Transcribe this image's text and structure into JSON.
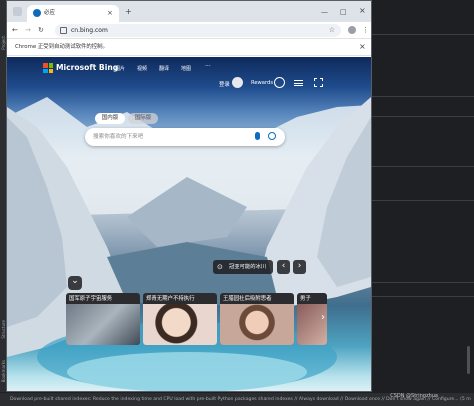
{
  "ide": {
    "left_labels": [
      "Project",
      "Structure",
      "Bookmarks"
    ],
    "status_text": "Download pre-built shared indexes: Reduce the indexing time and CPU load with pre-built Python packages shared indexes // Always download // Download once // Don't show again // Configure... (5 m",
    "watermark": "CSDN @Stringzhua"
  },
  "browser": {
    "tab_title": "必应",
    "tab_close": "×",
    "new_tab": "+",
    "window_controls": {
      "minimize": "—",
      "maximize": "□",
      "close": "×"
    },
    "url": "cn.bing.com",
    "automation_notice": "Chrome 正受到自动测试软件的控制。",
    "nav": {
      "back": "←",
      "forward": "→",
      "reload": "↻"
    }
  },
  "bing": {
    "brand": "Microsoft Bing",
    "nav_items": [
      "图片",
      "视频",
      "翻译",
      "地图",
      "···"
    ],
    "login": "登录",
    "rewards": "Rewards",
    "scope_tabs": [
      {
        "label": "国内版",
        "active": true
      },
      {
        "label": "国际版",
        "active": false
      }
    ],
    "search_placeholder": "搜索你喜欢的下来吧",
    "location_label": "冠亚可能的冰川",
    "prev": "‹",
    "next": "›",
    "collapse": "⌄",
    "news_cards": [
      {
        "title": "国军原子宇宙服务"
      },
      {
        "title": "郑青无期户不持执行"
      },
      {
        "title": "王腊园社后吸附思者"
      },
      {
        "title": "男子"
      }
    ]
  },
  "colors": {
    "bing_blue": "#0f6cbd",
    "chrome_frame": "#dee3ea",
    "ide_bg": "#2b2d30"
  }
}
